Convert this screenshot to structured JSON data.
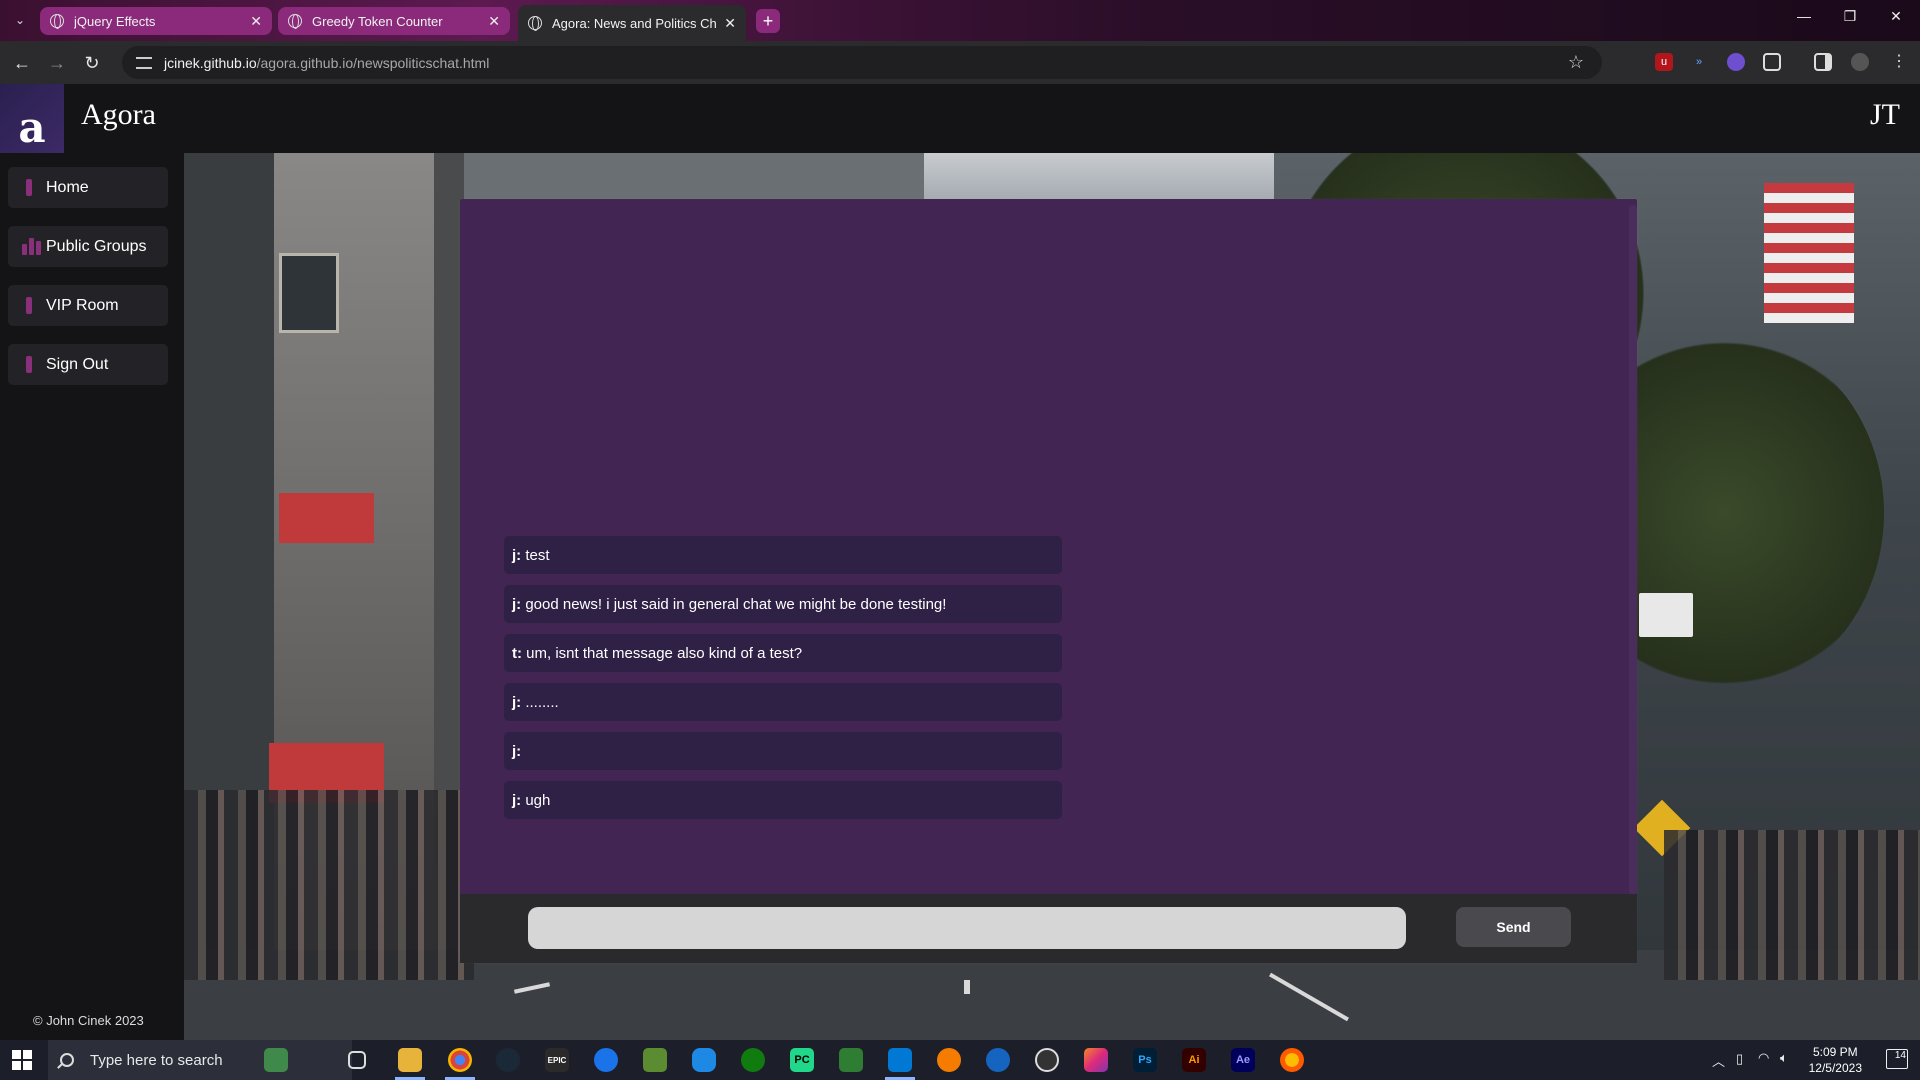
{
  "browser": {
    "tabs": [
      {
        "title": "jQuery Effects",
        "state": "inactive"
      },
      {
        "title": "Greedy Token Counter",
        "state": "inactive"
      },
      {
        "title": "Agora: News and Politics Chat",
        "state": "active"
      }
    ],
    "new_tab_symbol": "+",
    "url_host": "jcinek.github.io",
    "url_path": "/agora.github.io/newspoliticschat.html"
  },
  "site": {
    "brand_letter": "a",
    "brand_name": "Agora",
    "user_initials": "JT",
    "sidebar": {
      "items": [
        {
          "label": "Home",
          "icon": "bar-icon"
        },
        {
          "label": "Public Groups",
          "icon": "bars-icon"
        },
        {
          "label": "VIP Room",
          "icon": "bar-icon"
        },
        {
          "label": "Sign Out",
          "icon": "bar-icon"
        }
      ],
      "copyright": "© John Cinek 2023"
    },
    "chat": {
      "messages": [
        {
          "sender": "j:",
          "text": " test"
        },
        {
          "sender": "j:",
          "text": " good news! i just said in general chat we might be done testing!"
        },
        {
          "sender": "t:",
          "text": " um, isnt that message also kind of a test?"
        },
        {
          "sender": "j:",
          "text": " ........"
        },
        {
          "sender": "j:",
          "text": ""
        },
        {
          "sender": "j:",
          "text": " ugh"
        }
      ],
      "input_value": "",
      "send_label": "Send"
    },
    "colors": {
      "panel": "#422553",
      "message_bg": "#2f2145",
      "accent": "#8a2f7a"
    }
  },
  "taskbar": {
    "search_placeholder": "Type here to search",
    "time": "5:09 PM",
    "date": "12/5/2023",
    "notification_count": "14",
    "apps": [
      "widgets-icon",
      "task-view-icon",
      "file-explorer-icon",
      "chrome-icon",
      "steam-icon",
      "epic-games-icon",
      "app-icon",
      "minecraft-icon",
      "app-icon",
      "xbox-icon",
      "pycharm-icon",
      "app-icon",
      "vscode-icon",
      "app-icon",
      "app-icon",
      "app-icon",
      "app-icon",
      "photoshop-icon",
      "illustrator-icon",
      "after-effects-icon",
      "firefox-icon"
    ],
    "app_labels": {
      "epic": "EPIC",
      "pycharm": "PC",
      "photoshop": "Ps",
      "illustrator": "Ai",
      "after_effects": "Ae"
    }
  }
}
